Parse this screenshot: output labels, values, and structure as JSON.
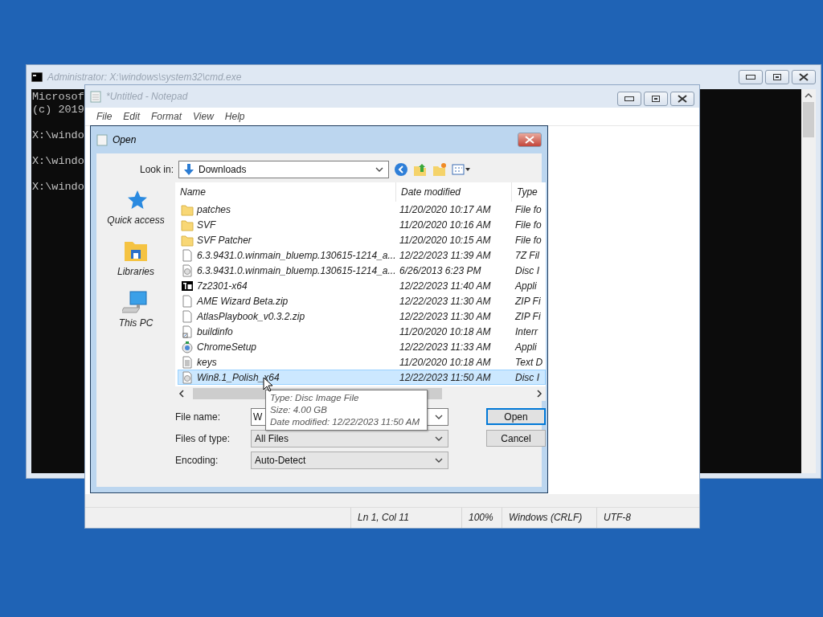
{
  "console_window": {
    "title": "Administrator: X:\\windows\\system32\\cmd.exe",
    "lines": [
      "Microsof",
      "(c) 2019"
    ],
    "prompts": [
      "X:\\windo",
      "X:\\windo",
      "X:\\windo"
    ]
  },
  "notepad_window": {
    "title": "*Untitled - Notepad",
    "menu": [
      "File",
      "Edit",
      "Format",
      "View",
      "Help"
    ],
    "status_bar": [
      "Ln 1, Col 11",
      "100%",
      "Windows (CRLF)",
      "UTF-8"
    ]
  },
  "open_dialog": {
    "title": "Open",
    "look_in": {
      "label": "Look in:",
      "value": "Downloads"
    },
    "places": [
      {
        "kind": "star",
        "label": "Quick access"
      },
      {
        "kind": "library",
        "label": "Libraries"
      },
      {
        "kind": "pc",
        "label": "This PC"
      }
    ],
    "columns": [
      "Name",
      "Date modified",
      "Type"
    ],
    "files": [
      {
        "kind": "folder",
        "name": "patches",
        "date": "11/20/2020 10:17 AM",
        "type": "File fo",
        "selected": false
      },
      {
        "kind": "folder",
        "name": "SVF",
        "date": "11/20/2020 10:16 AM",
        "type": "File fo",
        "selected": false
      },
      {
        "kind": "folder",
        "name": "SVF Patcher",
        "date": "11/20/2020 10:15 AM",
        "type": "File fo",
        "selected": false
      },
      {
        "kind": "file",
        "name": "6.3.9431.0.winmain_bluemp.130615-1214_a...",
        "date": "12/22/2023 11:39 AM",
        "type": "7Z Fil",
        "selected": false
      },
      {
        "kind": "disc",
        "name": "6.3.9431.0.winmain_bluemp.130615-1214_a...",
        "date": "6/26/2013 6:23 PM",
        "type": "Disc I",
        "selected": false
      },
      {
        "kind": "archiver",
        "name": "7z2301-x64",
        "date": "12/22/2023 11:40 AM",
        "type": "Appli",
        "selected": false
      },
      {
        "kind": "file",
        "name": "AME Wizard Beta.zip",
        "date": "12/22/2023 11:30 AM",
        "type": "ZIP Fi",
        "selected": false
      },
      {
        "kind": "file",
        "name": "AtlasPlaybook_v0.3.2.zip",
        "date": "12/22/2023 11:30 AM",
        "type": "ZIP Fi",
        "selected": false
      },
      {
        "kind": "shortcut",
        "name": "buildinfo",
        "date": "11/20/2020 10:18 AM",
        "type": "Interr",
        "selected": false
      },
      {
        "kind": "setup",
        "name": "ChromeSetup",
        "date": "12/22/2023 11:33 AM",
        "type": "Appli",
        "selected": false
      },
      {
        "kind": "text",
        "name": "keys",
        "date": "11/20/2020 10:18 AM",
        "type": "Text D",
        "selected": false
      },
      {
        "kind": "disc",
        "name": "Win8.1_Polish_x64",
        "date": "12/22/2023 11:50 AM",
        "type": "Disc I",
        "selected": true
      }
    ],
    "file_name": {
      "label": "File name:",
      "value": "W"
    },
    "files_of_type": {
      "label": "Files of type:",
      "value": "All Files"
    },
    "encoding": {
      "label": "Encoding:",
      "value": "Auto-Detect"
    },
    "buttons": [
      "Open",
      "Cancel"
    ],
    "tooltip": [
      "Type: Disc Image File",
      "Size: 4.00 GB",
      "Date modified: 12/22/2023 11:50 AM"
    ]
  }
}
